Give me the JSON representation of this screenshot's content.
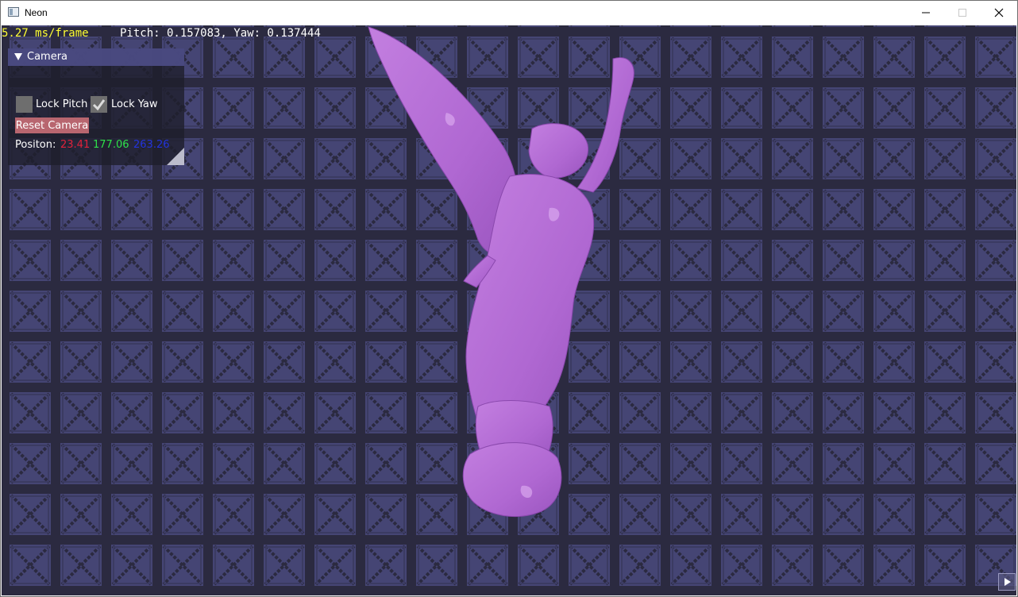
{
  "window": {
    "title": "Neon",
    "app_icon": "app-window-icon",
    "controls": [
      "minimize-icon",
      "maximize-icon",
      "close-icon"
    ]
  },
  "hud": {
    "frametime": "5.27 ms/frame",
    "pitch_yaw": "Pitch: 0.157083, Yaw: 0.137444"
  },
  "camera_panel": {
    "title": "Camera",
    "lock_pitch_label": "Lock Pitch",
    "lock_pitch_checked": false,
    "lock_yaw_label": "Lock Yaw",
    "lock_yaw_checked": true,
    "reset_button": "Reset Camera",
    "position_label": "Positon:",
    "position_x": "23.41",
    "position_y": "177.06",
    "position_z": "263.26"
  },
  "colors": {
    "background_tile": "#454574",
    "grid_line": "#2b2a40",
    "statue": "#b76ad6",
    "frametime_text": "#ffff33",
    "pos_x": "#e0223a",
    "pos_y": "#2ee24a",
    "pos_z": "#2233dd",
    "reset_button": "#b8666f"
  }
}
